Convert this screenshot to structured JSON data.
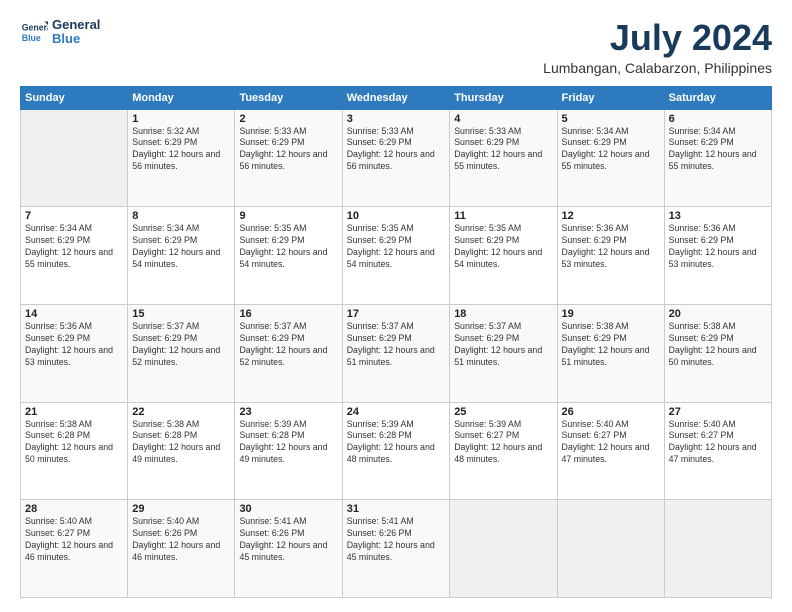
{
  "logo": {
    "line1": "General",
    "line2": "Blue"
  },
  "header": {
    "month": "July 2024",
    "location": "Lumbangan, Calabarzon, Philippines"
  },
  "weekdays": [
    "Sunday",
    "Monday",
    "Tuesday",
    "Wednesday",
    "Thursday",
    "Friday",
    "Saturday"
  ],
  "weeks": [
    [
      {
        "day": "",
        "sunrise": "",
        "sunset": "",
        "daylight": ""
      },
      {
        "day": "1",
        "sunrise": "5:32 AM",
        "sunset": "6:29 PM",
        "daylight": "12 hours and 56 minutes."
      },
      {
        "day": "2",
        "sunrise": "5:33 AM",
        "sunset": "6:29 PM",
        "daylight": "12 hours and 56 minutes."
      },
      {
        "day": "3",
        "sunrise": "5:33 AM",
        "sunset": "6:29 PM",
        "daylight": "12 hours and 56 minutes."
      },
      {
        "day": "4",
        "sunrise": "5:33 AM",
        "sunset": "6:29 PM",
        "daylight": "12 hours and 55 minutes."
      },
      {
        "day": "5",
        "sunrise": "5:34 AM",
        "sunset": "6:29 PM",
        "daylight": "12 hours and 55 minutes."
      },
      {
        "day": "6",
        "sunrise": "5:34 AM",
        "sunset": "6:29 PM",
        "daylight": "12 hours and 55 minutes."
      }
    ],
    [
      {
        "day": "7",
        "sunrise": "5:34 AM",
        "sunset": "6:29 PM",
        "daylight": "12 hours and 55 minutes."
      },
      {
        "day": "8",
        "sunrise": "5:34 AM",
        "sunset": "6:29 PM",
        "daylight": "12 hours and 54 minutes."
      },
      {
        "day": "9",
        "sunrise": "5:35 AM",
        "sunset": "6:29 PM",
        "daylight": "12 hours and 54 minutes."
      },
      {
        "day": "10",
        "sunrise": "5:35 AM",
        "sunset": "6:29 PM",
        "daylight": "12 hours and 54 minutes."
      },
      {
        "day": "11",
        "sunrise": "5:35 AM",
        "sunset": "6:29 PM",
        "daylight": "12 hours and 54 minutes."
      },
      {
        "day": "12",
        "sunrise": "5:36 AM",
        "sunset": "6:29 PM",
        "daylight": "12 hours and 53 minutes."
      },
      {
        "day": "13",
        "sunrise": "5:36 AM",
        "sunset": "6:29 PM",
        "daylight": "12 hours and 53 minutes."
      }
    ],
    [
      {
        "day": "14",
        "sunrise": "5:36 AM",
        "sunset": "6:29 PM",
        "daylight": "12 hours and 53 minutes."
      },
      {
        "day": "15",
        "sunrise": "5:37 AM",
        "sunset": "6:29 PM",
        "daylight": "12 hours and 52 minutes."
      },
      {
        "day": "16",
        "sunrise": "5:37 AM",
        "sunset": "6:29 PM",
        "daylight": "12 hours and 52 minutes."
      },
      {
        "day": "17",
        "sunrise": "5:37 AM",
        "sunset": "6:29 PM",
        "daylight": "12 hours and 51 minutes."
      },
      {
        "day": "18",
        "sunrise": "5:37 AM",
        "sunset": "6:29 PM",
        "daylight": "12 hours and 51 minutes."
      },
      {
        "day": "19",
        "sunrise": "5:38 AM",
        "sunset": "6:29 PM",
        "daylight": "12 hours and 51 minutes."
      },
      {
        "day": "20",
        "sunrise": "5:38 AM",
        "sunset": "6:29 PM",
        "daylight": "12 hours and 50 minutes."
      }
    ],
    [
      {
        "day": "21",
        "sunrise": "5:38 AM",
        "sunset": "6:28 PM",
        "daylight": "12 hours and 50 minutes."
      },
      {
        "day": "22",
        "sunrise": "5:38 AM",
        "sunset": "6:28 PM",
        "daylight": "12 hours and 49 minutes."
      },
      {
        "day": "23",
        "sunrise": "5:39 AM",
        "sunset": "6:28 PM",
        "daylight": "12 hours and 49 minutes."
      },
      {
        "day": "24",
        "sunrise": "5:39 AM",
        "sunset": "6:28 PM",
        "daylight": "12 hours and 48 minutes."
      },
      {
        "day": "25",
        "sunrise": "5:39 AM",
        "sunset": "6:27 PM",
        "daylight": "12 hours and 48 minutes."
      },
      {
        "day": "26",
        "sunrise": "5:40 AM",
        "sunset": "6:27 PM",
        "daylight": "12 hours and 47 minutes."
      },
      {
        "day": "27",
        "sunrise": "5:40 AM",
        "sunset": "6:27 PM",
        "daylight": "12 hours and 47 minutes."
      }
    ],
    [
      {
        "day": "28",
        "sunrise": "5:40 AM",
        "sunset": "6:27 PM",
        "daylight": "12 hours and 46 minutes."
      },
      {
        "day": "29",
        "sunrise": "5:40 AM",
        "sunset": "6:26 PM",
        "daylight": "12 hours and 46 minutes."
      },
      {
        "day": "30",
        "sunrise": "5:41 AM",
        "sunset": "6:26 PM",
        "daylight": "12 hours and 45 minutes."
      },
      {
        "day": "31",
        "sunrise": "5:41 AM",
        "sunset": "6:26 PM",
        "daylight": "12 hours and 45 minutes."
      },
      {
        "day": "",
        "sunrise": "",
        "sunset": "",
        "daylight": ""
      },
      {
        "day": "",
        "sunrise": "",
        "sunset": "",
        "daylight": ""
      },
      {
        "day": "",
        "sunrise": "",
        "sunset": "",
        "daylight": ""
      }
    ]
  ]
}
